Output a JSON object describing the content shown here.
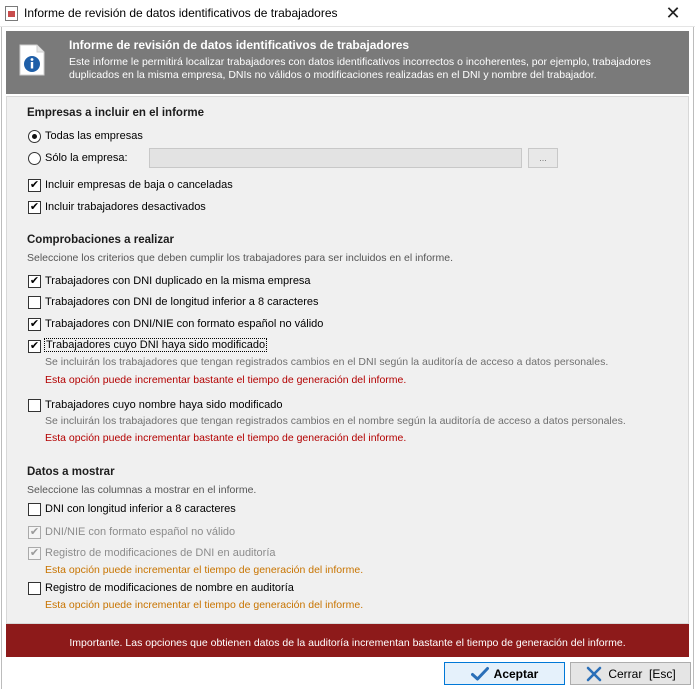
{
  "window": {
    "title": "Informe de revisión de datos identificativos de trabajadores"
  },
  "banner": {
    "title": "Informe de revisión de datos identificativos de trabajadores",
    "description": "Este informe le permitirá localizar trabajadores con datos identificativos incorrectos o incoherentes, por ejemplo, trabajadores duplicados en la misma empresa, DNIs no válidos o modificaciones realizadas en el DNI y nombre del trabajador."
  },
  "empresas": {
    "title": "Empresas a incluir en el informe",
    "radio_all": {
      "label": "Todas las empresas",
      "selected": true
    },
    "radio_one": {
      "label": "Sólo la empresa:",
      "selected": false
    },
    "company_value": "",
    "browse_label": "...",
    "check_baja": {
      "label": "Incluir empresas de baja o canceladas",
      "checked": true
    },
    "check_desactivados": {
      "label": "Incluir trabajadores desactivados",
      "checked": true
    }
  },
  "comprobaciones": {
    "title": "Comprobaciones a realizar",
    "subtitle": "Seleccione los criterios que deben cumplir los trabajadores para ser incluidos en el informe.",
    "items": [
      {
        "label": "Trabajadores con DNI duplicado en la misma empresa",
        "checked": true
      },
      {
        "label": "Trabajadores con DNI de longitud inferior a 8 caracteres",
        "checked": false
      },
      {
        "label": "Trabajadores con DNI/NIE con formato español no válido",
        "checked": true
      },
      {
        "label": "Trabajadores cuyo DNI haya sido modificado",
        "checked": true,
        "note": "Se incluirán los trabajadores que tengan registrados cambios en el DNI según la auditoría de acceso a datos personales.",
        "warning": "Esta opción puede incrementar bastante el tiempo de generación del informe."
      },
      {
        "label": "Trabajadores cuyo nombre haya sido modificado",
        "checked": false,
        "note": "Se incluirán los trabajadores que tengan registrados cambios en el nombre según la auditoría de acceso a datos personales.",
        "warning": "Esta opción puede incrementar bastante el tiempo de generación del informe."
      }
    ]
  },
  "datos": {
    "title": "Datos a mostrar",
    "subtitle": "Seleccione las columnas a mostrar en el informe.",
    "items": [
      {
        "label": "DNI con longitud inferior a 8 caracteres",
        "checked": false,
        "enabled": true
      },
      {
        "label": "DNI/NIE con formato español no válido",
        "checked": true,
        "enabled": false
      },
      {
        "label": "Registro de modificaciones de DNI en auditoría",
        "checked": true,
        "enabled": false,
        "warning": "Esta opción puede incrementar el tiempo de generación del informe."
      },
      {
        "label": "Registro de modificaciones de nombre en auditoría",
        "checked": false,
        "enabled": true,
        "warning": "Esta opción puede incrementar el tiempo de generación del informe."
      }
    ]
  },
  "footer": {
    "notice": "Importante. Las opciones que obtienen datos de la auditoría incrementan bastante el tiempo de generación del informe."
  },
  "buttons": {
    "accept": "Aceptar",
    "close": "Cerrar  [Esc]"
  },
  "colors": {
    "banner_bg": "#7a7a7a",
    "footer_bg": "#8d1a1a",
    "warning_red": "#b30000",
    "warning_orange": "#c87400"
  }
}
